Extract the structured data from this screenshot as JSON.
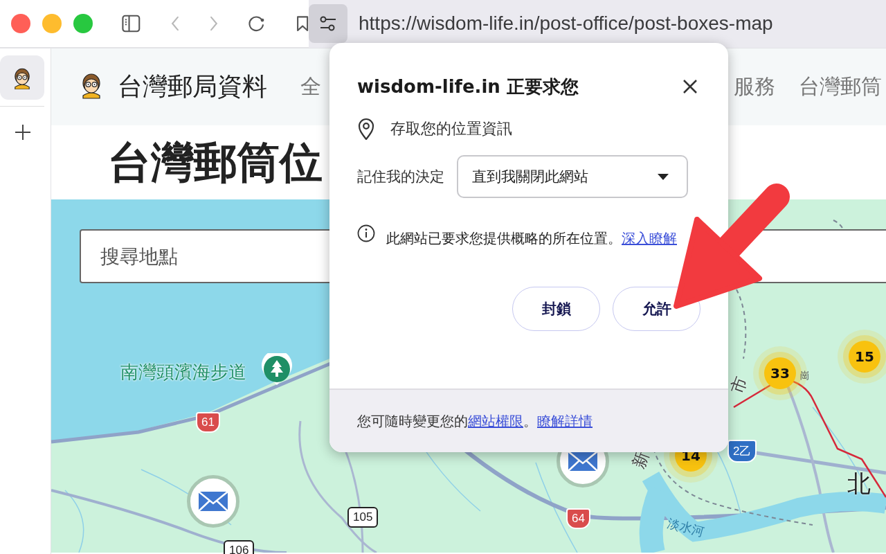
{
  "browser": {
    "traffic_lights": [
      {
        "color": "#ff5f57"
      },
      {
        "color": "#febc2e"
      },
      {
        "color": "#28c840"
      }
    ],
    "url": "https://wisdom-life.in/post-office/post-boxes-map"
  },
  "vertical_tabs": [
    {
      "selected": true
    }
  ],
  "site": {
    "logo_text": "台灣郵局資料",
    "nav": [
      "全",
      "服務",
      "台灣郵筒"
    ],
    "page_title": "台灣郵筒位"
  },
  "map": {
    "search": {
      "placeholder": "搜尋地點"
    },
    "place": {
      "label": "南灣頭濱海步道"
    },
    "shields": [
      {
        "text": "61",
        "kind": "provincial"
      },
      {
        "text": "105",
        "kind": "county"
      },
      {
        "text": "106",
        "kind": "county"
      },
      {
        "text": "64",
        "kind": "provincial"
      },
      {
        "text": "2乙",
        "kind": "national"
      }
    ],
    "clusters": [
      {
        "count": "33"
      },
      {
        "count": "15"
      },
      {
        "count": "14"
      }
    ],
    "labels": [
      {
        "text": "淡水河",
        "kind": "river"
      },
      {
        "text": "北",
        "kind": "city"
      },
      {
        "text": "新",
        "kind": "area"
      },
      {
        "text": "市",
        "kind": "area"
      },
      {
        "text": "崗",
        "kind": "small"
      }
    ]
  },
  "permission_prompt": {
    "title": "wisdom-life.in 正要求您",
    "permission": "存取您的位置資訊",
    "remember_label": "記住我的決定",
    "remember_value": "直到我關閉此網站",
    "info_text": "此網站已要求您提供概略的所在位置。",
    "info_link": "深入瞭解",
    "buttons": [
      "封鎖",
      "允許"
    ],
    "footer": [
      {
        "kind": "text",
        "text": "您可隨時變更您的"
      },
      {
        "kind": "link",
        "text": "網站權限"
      },
      {
        "kind": "text",
        "text": "。"
      },
      {
        "kind": "link",
        "text": "瞭解詳情"
      }
    ]
  }
}
